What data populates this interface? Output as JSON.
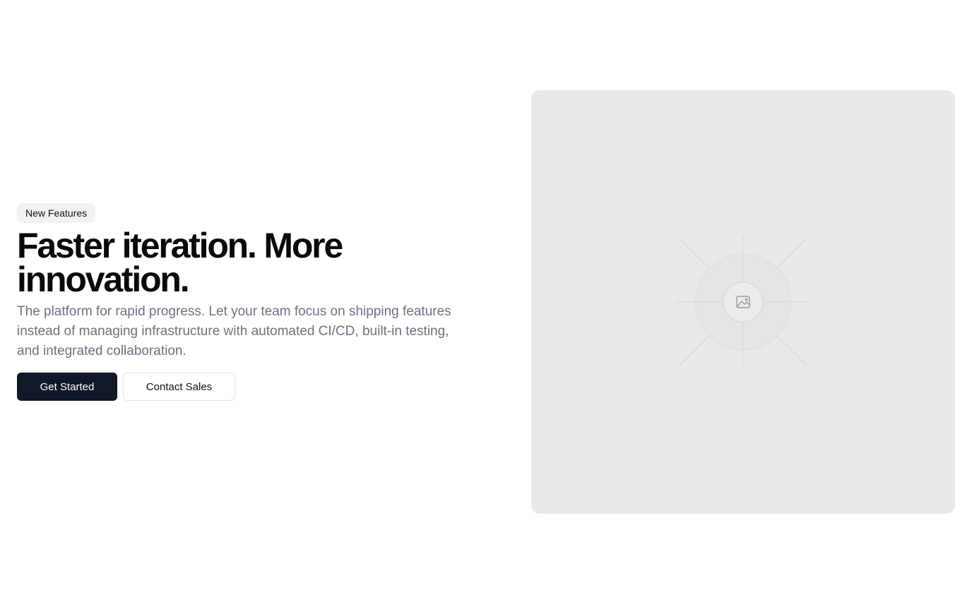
{
  "hero": {
    "badge": "New Features",
    "title": "Faster iteration. More innovation.",
    "description": "The platform for rapid progress. Let your team focus on shipping features instead of managing infrastructure with automated CI/CD, built-in testing, and integrated collaboration.",
    "primary_cta": "Get Started",
    "secondary_cta": "Contact Sales"
  },
  "media": {
    "icon": "image-placeholder-icon"
  },
  "colors": {
    "primary_button": "#111827",
    "placeholder_bg": "#e8e8e8",
    "muted_text": "#6b7280"
  }
}
